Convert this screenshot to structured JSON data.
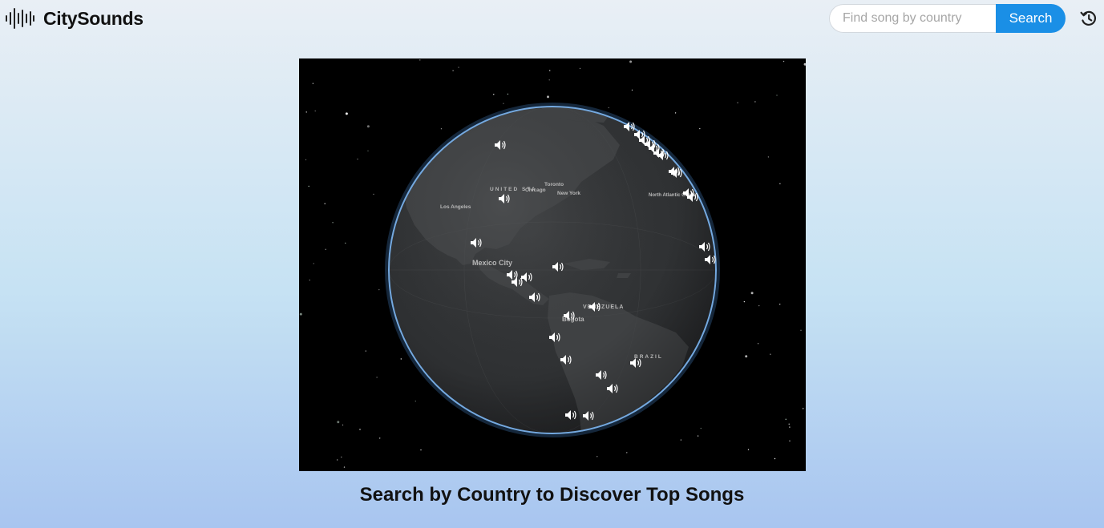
{
  "header": {
    "brand_name": "CitySounds",
    "brand_icon": "sound-wave-icon",
    "search": {
      "placeholder": "Find song by country",
      "value": "",
      "button_label": "Search"
    },
    "history_icon": "history-icon"
  },
  "globe": {
    "marker_icon": "speaker-icon",
    "colors": {
      "space": "#000000",
      "ocean": "#2f3133",
      "land": "#3d3f41",
      "atmosphere": "#6fa3d8",
      "marker": "#ffffff"
    },
    "place_labels": {
      "united_states": "UNITED STA",
      "chicago": "Chicago",
      "toronto": "Toronto",
      "new_york": "New York",
      "los_angeles": "Los Angeles",
      "mexico_city": "Mexico City",
      "venezuela": "VENEZUELA",
      "bogota": "Bogota",
      "brazil": "BRAZIL",
      "north_atlantic_ocean": "North Atlantic Ocean"
    }
  },
  "main": {
    "headline": "Search by Country to Discover Top Songs"
  }
}
